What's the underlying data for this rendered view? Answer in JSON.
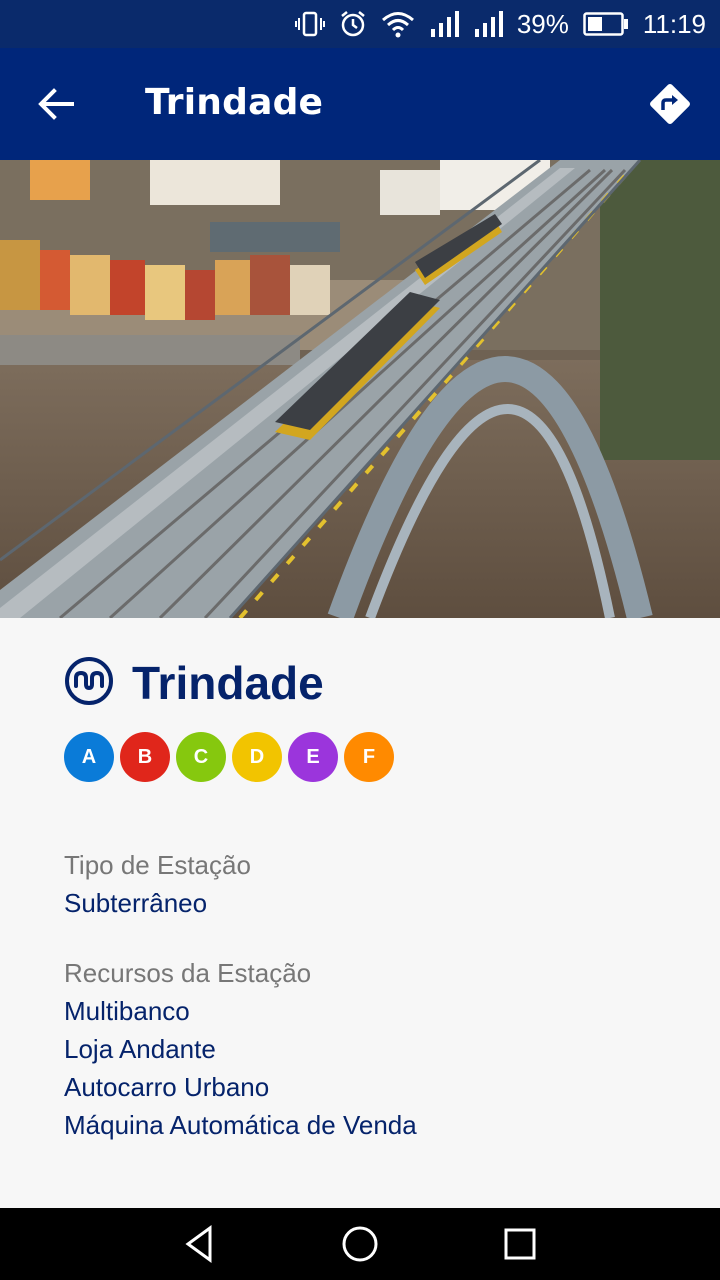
{
  "status_bar": {
    "battery": "39%",
    "time": "11:19"
  },
  "app_bar": {
    "title": "Trindade",
    "back_icon": "arrow-left-icon",
    "directions_icon": "directions-icon"
  },
  "station": {
    "name": "Trindade",
    "logo_icon": "metro-logo-icon",
    "lines": [
      {
        "label": "A",
        "color": "#0a7bd8"
      },
      {
        "label": "B",
        "color": "#e0261b"
      },
      {
        "label": "C",
        "color": "#86c80e"
      },
      {
        "label": "D",
        "color": "#f2c400"
      },
      {
        "label": "E",
        "color": "#9b35dc"
      },
      {
        "label": "F",
        "color": "#ff8a00"
      }
    ],
    "type_label": "Tipo de Estação",
    "type_value": "Subterrâneo",
    "resources_label": "Recursos da Estação",
    "resources": [
      "Multibanco",
      "Loja Andante",
      "Autocarro Urbano",
      "Máquina Automática de Venda"
    ]
  },
  "colors": {
    "primary": "#00267a",
    "text_primary": "#05236b",
    "text_secondary": "#777777"
  }
}
